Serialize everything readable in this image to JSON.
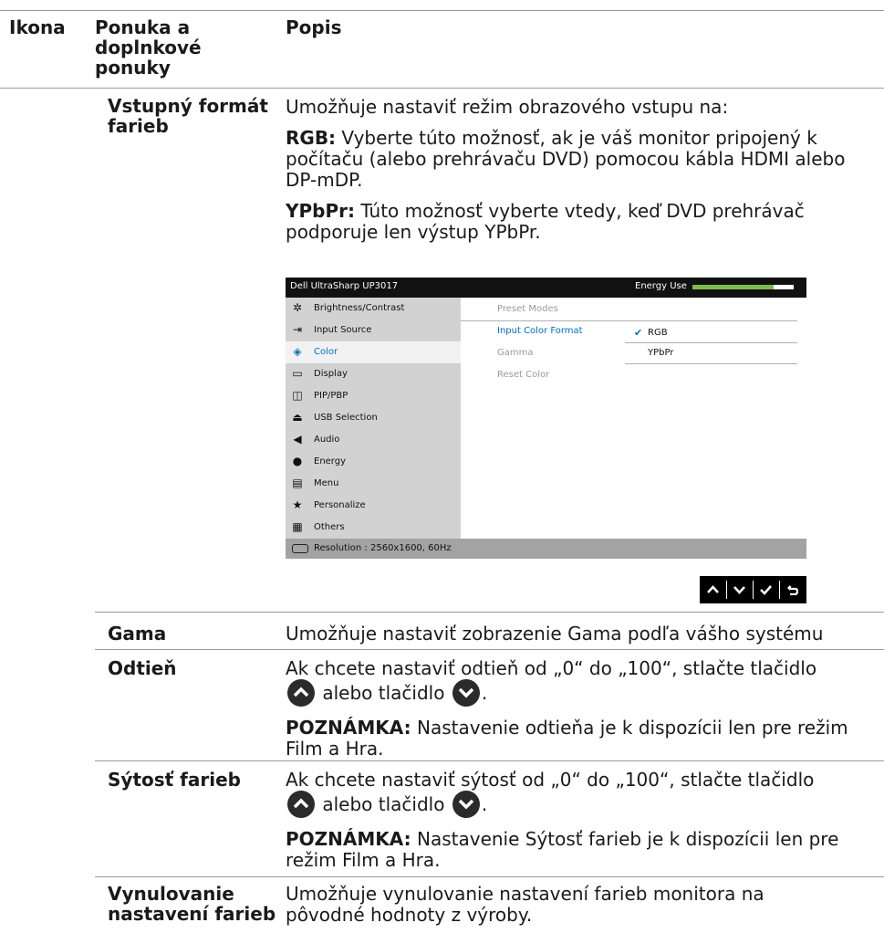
{
  "header": {
    "col1": "Ikona",
    "col2": "Ponuka a doplnkové ponuky",
    "col3": "Popis"
  },
  "rows": {
    "vstupny": {
      "label": "Vstupný formát farieb",
      "intro": "Umožňuje nastaviť režim obrazového vstupu na:",
      "rgb_term": "RGB:",
      "rgb_text": " Vyberte túto možnosť, ak je váš monitor pripojený k počítaču (alebo prehrávaču DVD) pomocou kábla HDMI alebo DP-mDP.",
      "ypbpr_term": "YPbPr:",
      "ypbpr_text": " Túto možnosť vyberte vtedy, keď DVD prehrávač podporuje len výstup YPbPr."
    },
    "gama": {
      "label": "Gama",
      "text": "Umožňuje nastaviť zobrazenie Gama podľa vášho systému"
    },
    "odtien": {
      "label": "Odtieň",
      "text_a": "Ak chcete nastaviť odtieň od „0“ do „100“, stlačte tlačidlo",
      "text_b": "alebo tlačidlo",
      "text_c": ".",
      "note_term": "POZNÁMKA:",
      "note_text": " Nastavenie odtieňa je k dispozícii len pre režim Film a Hra."
    },
    "sytost": {
      "label": "Sýtosť farieb",
      "text_a": "Ak chcete nastaviť sýtosť od „0“ do „100“, stlačte tlačidlo",
      "text_b": "alebo tlačidlo",
      "text_c": ".",
      "note_term": "POZNÁMKA:",
      "note_text": " Nastavenie Sýtosť farieb je k dispozícii len pre režim Film a Hra."
    },
    "vynulovanie": {
      "label": "Vynulovanie nastavení farieb",
      "text": "Umožňuje vynulovanie nastavení farieb monitora na pôvodné hodnoty z výroby."
    }
  },
  "osd": {
    "title": "Dell UltraSharp UP3017",
    "energy_label": "Energy Use",
    "energy_level": 0.8,
    "menu": [
      {
        "label": "Brightness/Contrast",
        "icon": "sun-icon"
      },
      {
        "label": "Input Source",
        "icon": "input-source-icon"
      },
      {
        "label": "Color",
        "icon": "color-icon"
      },
      {
        "label": "Display",
        "icon": "display-icon"
      },
      {
        "label": "PIP/PBP",
        "icon": "pip-icon"
      },
      {
        "label": "USB Selection",
        "icon": "usb-icon"
      },
      {
        "label": "Audio",
        "icon": "speaker-icon"
      },
      {
        "label": "Energy",
        "icon": "energy-icon"
      },
      {
        "label": "Menu",
        "icon": "menu-icon"
      },
      {
        "label": "Personalize",
        "icon": "star-icon"
      },
      {
        "label": "Others",
        "icon": "others-icon"
      }
    ],
    "selected_menu": "Color",
    "submenu": [
      "Preset Modes",
      "Input Color Format",
      "Gamma",
      "Reset Color"
    ],
    "selected_submenu": "Input Color Format",
    "options": [
      "RGB",
      "YPbPr"
    ],
    "selected_option": "RGB",
    "resolution": "Resolution : 2560x1600, 60Hz",
    "accent_color": "#0070c0",
    "energy_color": "#7dbb4a"
  },
  "nav_buttons": [
    "up-icon",
    "down-icon",
    "check-icon",
    "back-icon"
  ]
}
